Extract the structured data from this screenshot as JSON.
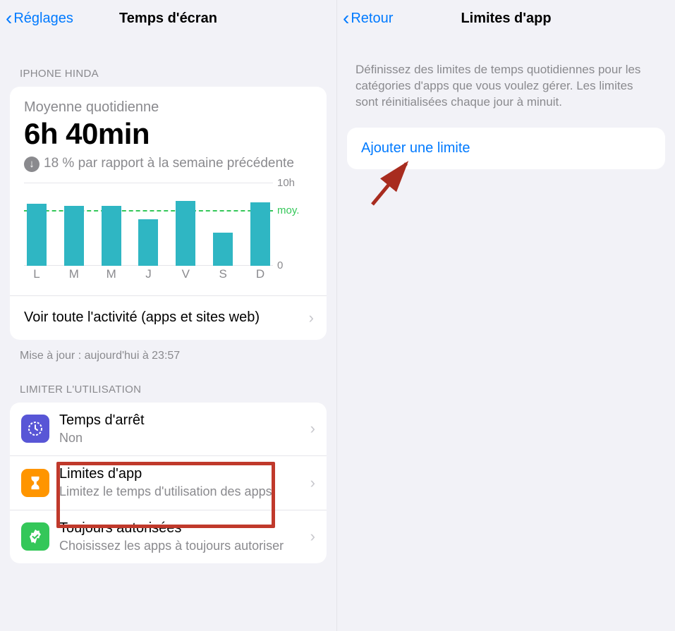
{
  "left": {
    "header": {
      "back": "Réglages",
      "title": "Temps d'écran"
    },
    "device_label": "IPHONE HINDA",
    "average": {
      "label": "Moyenne quotidienne",
      "value": "6h 40min",
      "delta": "18 % par rapport à la semaine précédente"
    },
    "chart_data": {
      "type": "bar",
      "categories": [
        "L",
        "M",
        "M",
        "J",
        "V",
        "S",
        "D"
      ],
      "values": [
        7.4,
        7.2,
        7.2,
        5.6,
        7.8,
        4.0,
        7.6
      ],
      "avg": 6.67,
      "ylim": [
        0,
        10
      ],
      "ylabel_top": "10h",
      "ylabel_avg": "moy.",
      "ylabel_bot": "0"
    },
    "activity_link": "Voir toute l'activité (apps et sites web)",
    "update_note": "Mise à jour : aujourd'hui à 23:57",
    "limit_label": "LIMITER L'UTILISATION",
    "rows": [
      {
        "title": "Temps d'arrêt",
        "sub": "Non"
      },
      {
        "title": "Limites d'app",
        "sub": "Limitez le temps d'utilisation des apps"
      },
      {
        "title": "Toujours autorisées",
        "sub": "Choisissez les apps à toujours autoriser"
      }
    ]
  },
  "right": {
    "header": {
      "back": "Retour",
      "title": "Limites d'app"
    },
    "description": "Définissez des limites de temps quotidiennes pour les catégories d'apps que vous voulez gérer. Les limites sont réinitialisées chaque jour à minuit.",
    "add_link": "Ajouter une limite"
  }
}
